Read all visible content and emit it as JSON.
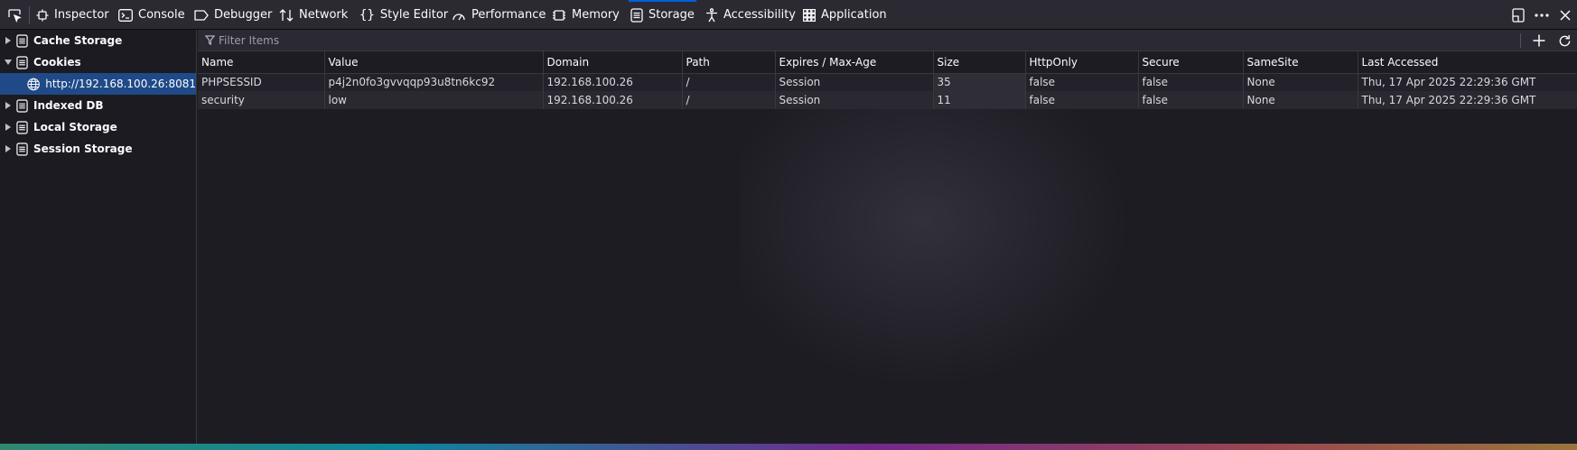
{
  "toolbar": {
    "tabs": [
      {
        "label": "Inspector",
        "icon": "inspector-icon"
      },
      {
        "label": "Console",
        "icon": "console-icon"
      },
      {
        "label": "Debugger",
        "icon": "debugger-icon"
      },
      {
        "label": "Network",
        "icon": "network-icon"
      },
      {
        "label": "Style Editor",
        "icon": "style-editor-icon"
      },
      {
        "label": "Performance",
        "icon": "performance-icon"
      },
      {
        "label": "Memory",
        "icon": "memory-icon"
      },
      {
        "label": "Storage",
        "icon": "storage-icon",
        "active": true
      },
      {
        "label": "Accessibility",
        "icon": "accessibility-icon"
      },
      {
        "label": "Application",
        "icon": "application-icon"
      }
    ],
    "accent_color": "#0060df"
  },
  "sidebar": {
    "items": [
      {
        "label": "Cache Storage",
        "expanded": false
      },
      {
        "label": "Cookies",
        "expanded": true,
        "children": [
          {
            "label": "http://192.168.100.26:8081",
            "selected": true
          }
        ]
      },
      {
        "label": "Indexed DB",
        "expanded": false
      },
      {
        "label": "Local Storage",
        "expanded": false
      },
      {
        "label": "Session Storage",
        "expanded": false
      }
    ],
    "selected_color": "#1f4a87"
  },
  "filter": {
    "placeholder": "Filter Items"
  },
  "table": {
    "columns": [
      "Name",
      "Value",
      "Domain",
      "Path",
      "Expires / Max-Age",
      "Size",
      "HttpOnly",
      "Secure",
      "SameSite",
      "Last Accessed"
    ],
    "rows": [
      [
        "PHPSESSID",
        "p4j2n0fo3gvvqqp93u8tn6kc92",
        "192.168.100.26",
        "/",
        "Session",
        "35",
        "false",
        "false",
        "None",
        "Thu, 17 Apr 2025 22:29:36 GMT"
      ],
      [
        "security",
        "low",
        "192.168.100.26",
        "/",
        "Session",
        "11",
        "false",
        "false",
        "None",
        "Thu, 17 Apr 2025 22:29:36 GMT"
      ]
    ]
  }
}
